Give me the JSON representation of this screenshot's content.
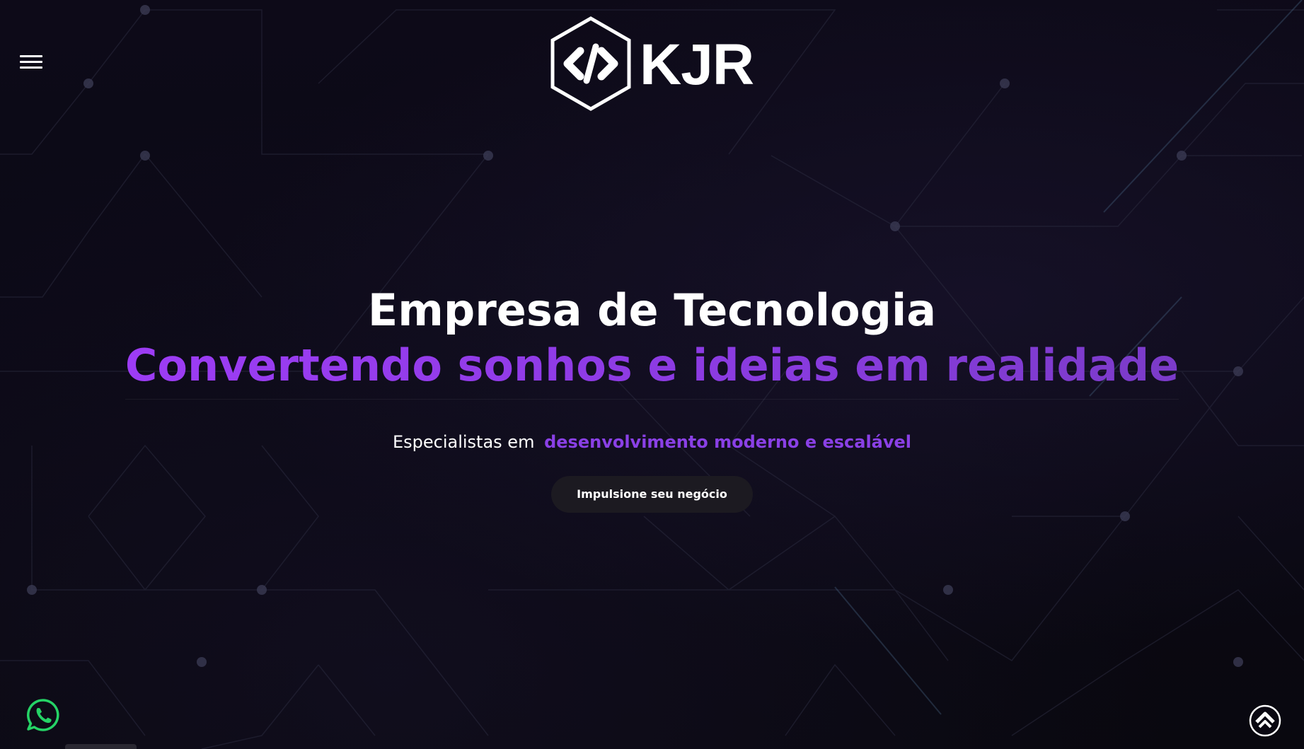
{
  "header": {
    "menu_icon": "hamburger-menu-icon",
    "logo": {
      "icon": "code-brackets-hexagon-icon",
      "text": "KJR"
    }
  },
  "hero": {
    "title": "Empresa de Tecnologia",
    "tagline": "Convertendo sonhos e ideias em realidade",
    "subtitle_prefix": "Especialistas em",
    "subtitle_accent": "desenvolvimento moderno e escalável",
    "cta_label": "Impulsione seu negócio"
  },
  "floating": {
    "whatsapp_icon": "whatsapp-icon",
    "scroll_top_icon": "chevron-up-circle-icon"
  },
  "colors": {
    "background": "#0a0812",
    "accent": "#8a40e6",
    "whatsapp": "#25d366",
    "button_bg": "#1c1a21"
  }
}
